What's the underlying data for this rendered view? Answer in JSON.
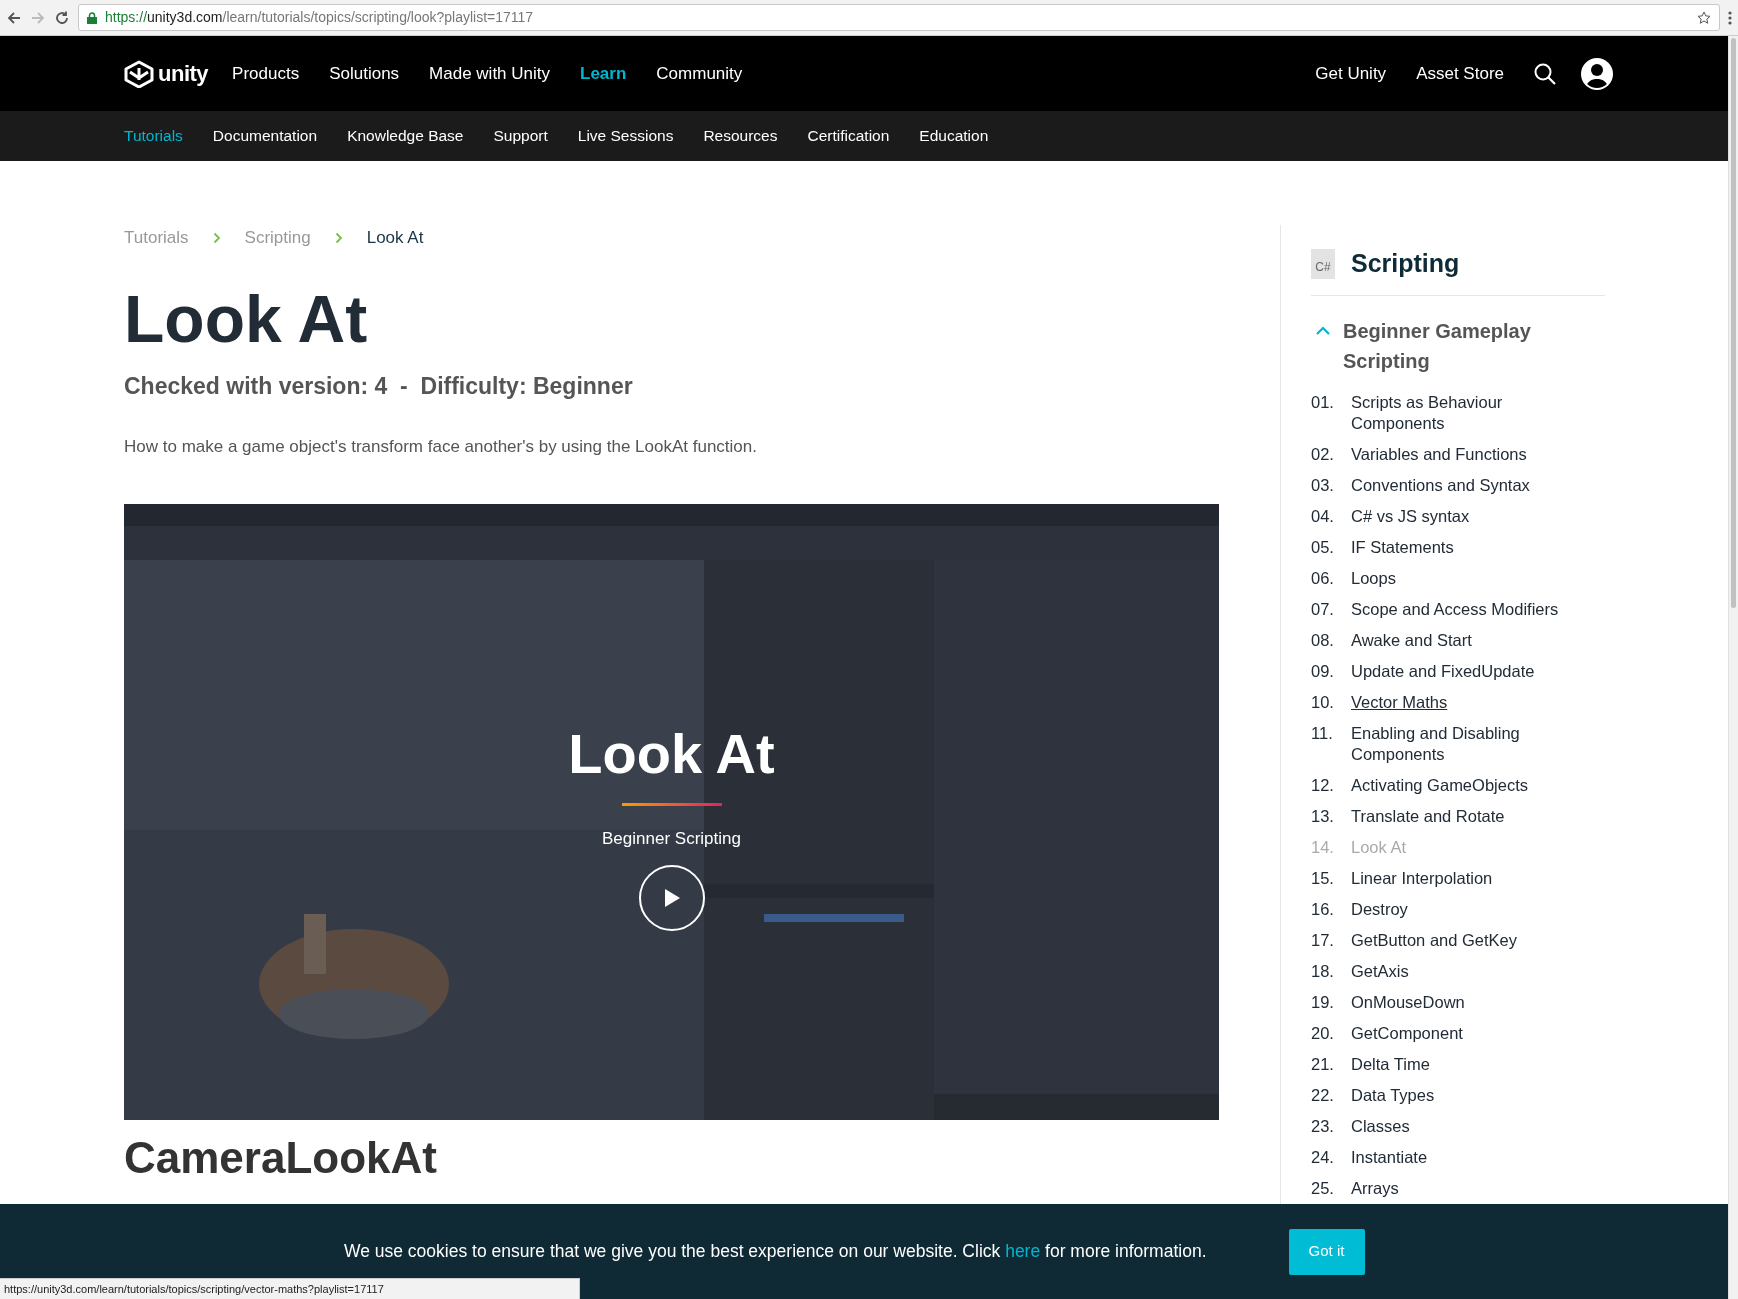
{
  "browser": {
    "scheme": "https://",
    "host": "unity3d.com",
    "path": "/learn/tutorials/topics/scripting/look?playlist=17117",
    "forward_disabled": true
  },
  "nav": {
    "logo": "unity",
    "items": [
      {
        "label": "Products",
        "selected": false
      },
      {
        "label": "Solutions",
        "selected": false
      },
      {
        "label": "Made with Unity",
        "selected": false
      },
      {
        "label": "Learn",
        "selected": true
      },
      {
        "label": "Community",
        "selected": false
      }
    ],
    "right": [
      "Get Unity",
      "Asset Store"
    ]
  },
  "subnav": {
    "items": [
      {
        "label": "Tutorials",
        "selected": true
      },
      {
        "label": "Documentation",
        "selected": false
      },
      {
        "label": "Knowledge Base",
        "selected": false
      },
      {
        "label": "Support",
        "selected": false
      },
      {
        "label": "Live Sessions",
        "selected": false
      },
      {
        "label": "Resources",
        "selected": false
      },
      {
        "label": "Certification",
        "selected": false
      },
      {
        "label": "Education",
        "selected": false
      }
    ]
  },
  "breadcrumb": [
    {
      "label": "Tutorials",
      "selected": false
    },
    {
      "label": "Scripting",
      "selected": false
    },
    {
      "label": "Look At",
      "selected": true
    }
  ],
  "title": "Look At",
  "meta": "Checked with version: 4  -  Difficulty: **Beginner**",
  "description": "How to make a game object's transform face another's by using the LookAt function.",
  "video": {
    "kind": "picture",
    "title": "Look At",
    "subtitle": "Beginner Scripting"
  },
  "next_heading": "CameraLookAt",
  "sidebar": {
    "icon_label": "C#",
    "title": "Scripting",
    "section": {
      "title": "Beginner Gameplay Scripting",
      "expanded": true
    },
    "lessons": [
      {
        "number": "01.",
        "title": "Scripts as Behaviour Components",
        "selected": false,
        "hovered": false
      },
      {
        "number": "02.",
        "title": "Variables and Functions",
        "selected": false,
        "hovered": false
      },
      {
        "number": "03.",
        "title": "Conventions and Syntax",
        "selected": false,
        "hovered": false
      },
      {
        "number": "04.",
        "title": "C# vs JS syntax",
        "selected": false,
        "hovered": false
      },
      {
        "number": "05.",
        "title": "IF Statements",
        "selected": false,
        "hovered": false
      },
      {
        "number": "06.",
        "title": "Loops",
        "selected": false,
        "hovered": false
      },
      {
        "number": "07.",
        "title": "Scope and Access Modifiers",
        "selected": false,
        "hovered": false
      },
      {
        "number": "08.",
        "title": "Awake and Start",
        "selected": false,
        "hovered": false
      },
      {
        "number": "09.",
        "title": "Update and FixedUpdate",
        "selected": false,
        "hovered": false
      },
      {
        "number": "10.",
        "title": "Vector Maths",
        "selected": false,
        "hovered": true
      },
      {
        "number": "11.",
        "title": "Enabling and Disabling Components",
        "selected": false,
        "hovered": false
      },
      {
        "number": "12.",
        "title": "Activating GameObjects",
        "selected": false,
        "hovered": false
      },
      {
        "number": "13.",
        "title": "Translate and Rotate",
        "selected": false,
        "hovered": false
      },
      {
        "number": "14.",
        "title": "Look At",
        "selected": true,
        "hovered": false
      },
      {
        "number": "15.",
        "title": "Linear Interpolation",
        "selected": false,
        "hovered": false
      },
      {
        "number": "16.",
        "title": "Destroy",
        "selected": false,
        "hovered": false
      },
      {
        "number": "17.",
        "title": "GetButton and GetKey",
        "selected": false,
        "hovered": false
      },
      {
        "number": "18.",
        "title": "GetAxis",
        "selected": false,
        "hovered": false
      },
      {
        "number": "19.",
        "title": "OnMouseDown",
        "selected": false,
        "hovered": false
      },
      {
        "number": "20.",
        "title": "GetComponent",
        "selected": false,
        "hovered": false
      },
      {
        "number": "21.",
        "title": "Delta Time",
        "selected": false,
        "hovered": false
      },
      {
        "number": "22.",
        "title": "Data Types",
        "selected": false,
        "hovered": false
      },
      {
        "number": "23.",
        "title": "Classes",
        "selected": false,
        "hovered": false
      },
      {
        "number": "24.",
        "title": "Instantiate",
        "selected": false,
        "hovered": false
      },
      {
        "number": "25.",
        "title": "Arrays",
        "selected": false,
        "hovered": false
      }
    ]
  },
  "cookie": {
    "text_before": "We use cookies to ensure that we give you the best experience on our website. Click ",
    "link": "here",
    "text_after": " for more information.",
    "button": "Got it"
  },
  "status_url": "https://unity3d.com/learn/tutorials/topics/scripting/vector-maths?playlist=17117"
}
